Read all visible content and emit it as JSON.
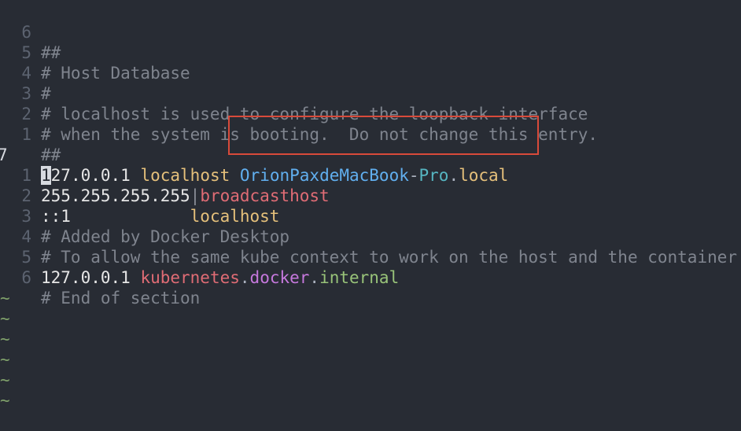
{
  "editor": {
    "lines": [
      {
        "num": "6",
        "text": "##"
      },
      {
        "num": "5",
        "text": "# Host Database"
      },
      {
        "num": "4",
        "text": "#"
      },
      {
        "num": "3",
        "text": "# localhost is used to configure the loopback interface"
      },
      {
        "num": "2",
        "text": "# when the system is booting.  Do not change this entry."
      },
      {
        "num": "1",
        "text": "##"
      }
    ],
    "current_line": {
      "num": "7",
      "cursor_char": "1",
      "ip_rest": "27.0.0.1",
      "host1": "localhost",
      "host2_part1": "OrionPaxdeMacBook",
      "host2_sep": "-",
      "host2_part2": "Pro",
      "host2_dot": ".",
      "host2_part3": "local"
    },
    "line_after_1": {
      "num": "1",
      "ip": "255.255.255.255",
      "pipe": "|",
      "host": "broadcasthost"
    },
    "line_after_2": {
      "num": "2",
      "ip": "::1",
      "host": "localhost"
    },
    "comment_after_3": {
      "num": "3",
      "text": "# Added by Docker Desktop"
    },
    "comment_after_4": {
      "num": "4",
      "text": "# To allow the same kube context to work on the host and the container:"
    },
    "line_after_5": {
      "num": "5",
      "ip": "127.0.0.1",
      "part1": "kubernetes",
      "dot1": ".",
      "part2": "docker",
      "dot2": ".",
      "part3": "internal"
    },
    "comment_after_6": {
      "num": "6",
      "text": "# End of section"
    },
    "tildes": [
      "~",
      "~",
      "~",
      "~",
      "~",
      "~"
    ]
  },
  "colors": {
    "background": "#282c34",
    "comment": "#7f848e",
    "highlight_box": "#d84a3a"
  }
}
